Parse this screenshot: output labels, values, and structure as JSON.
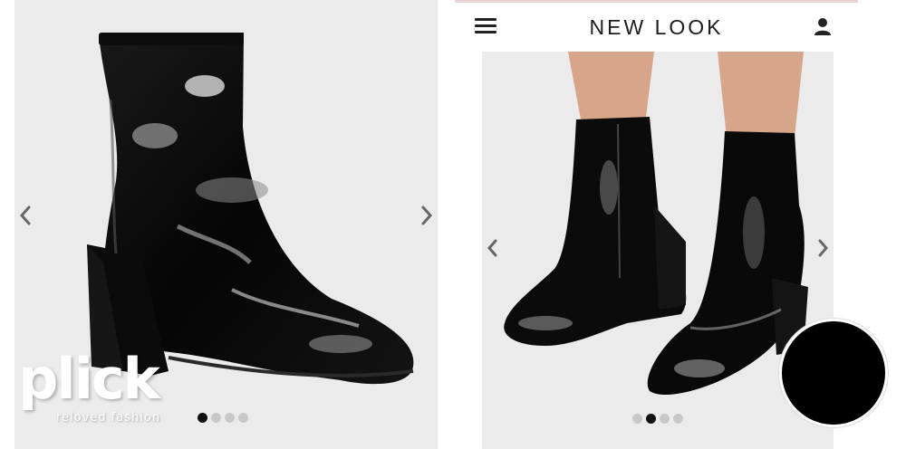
{
  "brand": {
    "name": "NEW LOOK"
  },
  "left_gallery": {
    "product_image": "black-patent-ankle-boot",
    "dots_total": 4,
    "dots_active_index": 0
  },
  "right_gallery": {
    "product_image": "model-wearing-black-patent-boots",
    "dots_total": 4,
    "dots_active_index": 1
  },
  "watermark": {
    "word": "plick",
    "tagline": "reloved fashion"
  },
  "icons": {
    "menu": "hamburger-icon",
    "account": "person-icon",
    "prev": "chevron-left-icon",
    "next": "chevron-right-icon"
  },
  "colors": {
    "background_gray": "#ebebeb",
    "strip_pink": "#e9d3d6",
    "dot_active": "#111111",
    "dot_inactive": "#c8c8c8"
  }
}
